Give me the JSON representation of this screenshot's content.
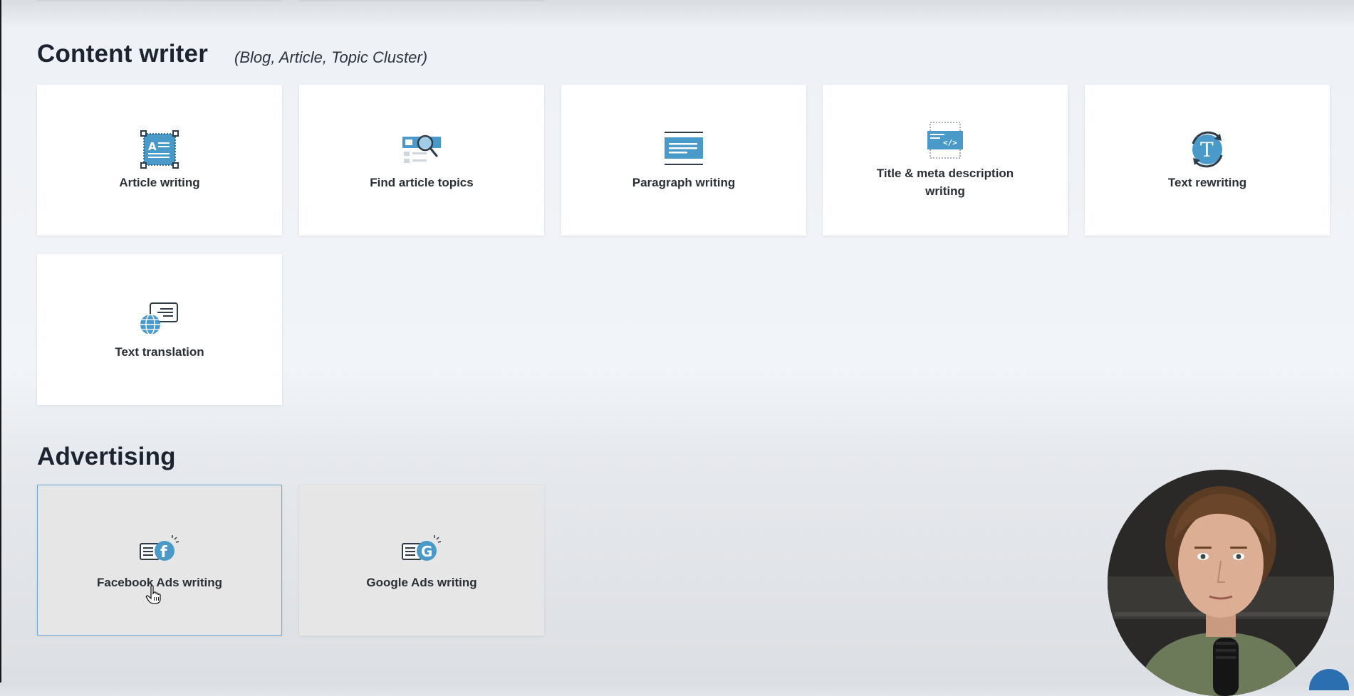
{
  "content_writer": {
    "title": "Content writer",
    "subtitle": "(Blog, Article, Topic Cluster)",
    "cards": [
      {
        "label": "Article writing",
        "icon": "article-writing-icon"
      },
      {
        "label": "Find article topics",
        "icon": "find-topics-icon"
      },
      {
        "label": "Paragraph writing",
        "icon": "paragraph-icon"
      },
      {
        "label": "Title & meta description writing",
        "icon": "title-meta-icon"
      },
      {
        "label": "Text rewriting",
        "icon": "text-rewriting-icon"
      },
      {
        "label": "Text translation",
        "icon": "translation-icon"
      }
    ]
  },
  "advertising": {
    "title": "Advertising",
    "cards": [
      {
        "label": "Facebook Ads writing",
        "icon": "facebook-ads-icon"
      },
      {
        "label": "Google Ads writing",
        "icon": "google-ads-icon"
      }
    ]
  },
  "colors": {
    "accent_blue": "#4a9ac9",
    "icon_dark": "#3b4a5a",
    "selected_border": "#6aa7d8"
  }
}
